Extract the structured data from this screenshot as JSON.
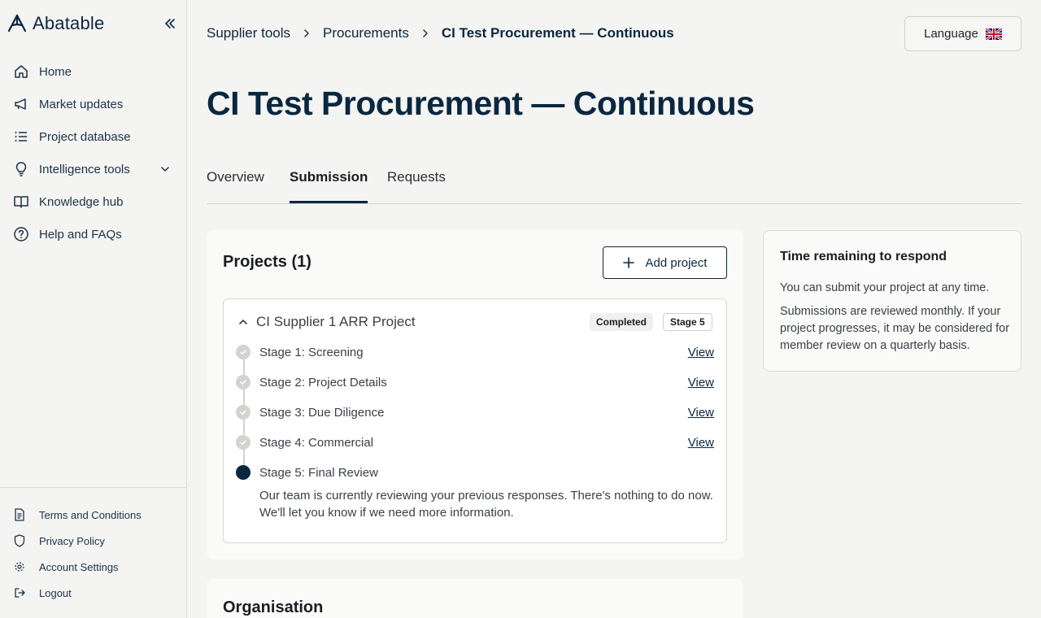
{
  "brand": {
    "name": "Abatable"
  },
  "sidebar": {
    "items": [
      {
        "label": "Home",
        "icon": "home-icon"
      },
      {
        "label": "Market updates",
        "icon": "megaphone-icon"
      },
      {
        "label": "Project database",
        "icon": "list-icon"
      },
      {
        "label": "Intelligence tools",
        "icon": "lightbulb-icon"
      },
      {
        "label": "Knowledge hub",
        "icon": "book-icon"
      },
      {
        "label": "Help and FAQs",
        "icon": "help-circle-icon"
      }
    ],
    "footer": [
      {
        "label": "Terms and Conditions",
        "icon": "document-icon"
      },
      {
        "label": "Privacy Policy",
        "icon": "shield-icon"
      },
      {
        "label": "Account Settings",
        "icon": "gear-icon"
      },
      {
        "label": "Logout",
        "icon": "logout-icon"
      }
    ]
  },
  "breadcrumb": {
    "items": [
      "Supplier tools",
      "Procurements"
    ],
    "current": "CI Test Procurement — Continuous"
  },
  "language": {
    "label": "Language",
    "flag": "uk-flag-icon"
  },
  "page": {
    "title": "CI Test Procurement — Continuous"
  },
  "tabs": [
    {
      "label": "Overview",
      "active": false
    },
    {
      "label": "Submission",
      "active": true
    },
    {
      "label": "Requests",
      "active": false
    }
  ],
  "projects": {
    "title": "Projects (1)",
    "add_label": "Add project",
    "project": {
      "name": "CI Supplier 1 ARR Project",
      "status_badge": "Completed",
      "stage_badge": "Stage 5",
      "stages": [
        {
          "label": "Stage 1: Screening",
          "link": "View",
          "state": "done"
        },
        {
          "label": "Stage 2: Project Details",
          "link": "View",
          "state": "done"
        },
        {
          "label": "Stage 3: Due Diligence",
          "link": "View",
          "state": "done"
        },
        {
          "label": "Stage 4: Commercial",
          "link": "View",
          "state": "done"
        },
        {
          "label": "Stage 5: Final Review",
          "link": "",
          "state": "current"
        }
      ],
      "note_line1": "Our team is currently reviewing your previous responses. There's nothing to do now.",
      "note_line2": "We'll let you know if we need more information."
    }
  },
  "time_remaining": {
    "title": "Time remaining to respond",
    "p1": "You can submit your project at any time.",
    "p2": "Submissions are reviewed monthly. If your project progresses, it may be considered for member review on a quarterly basis."
  },
  "organisation": {
    "title": "Organisation"
  },
  "colors": {
    "brand": "#0b2740",
    "background": "#f4f4f2",
    "card": "#fafaf9"
  }
}
